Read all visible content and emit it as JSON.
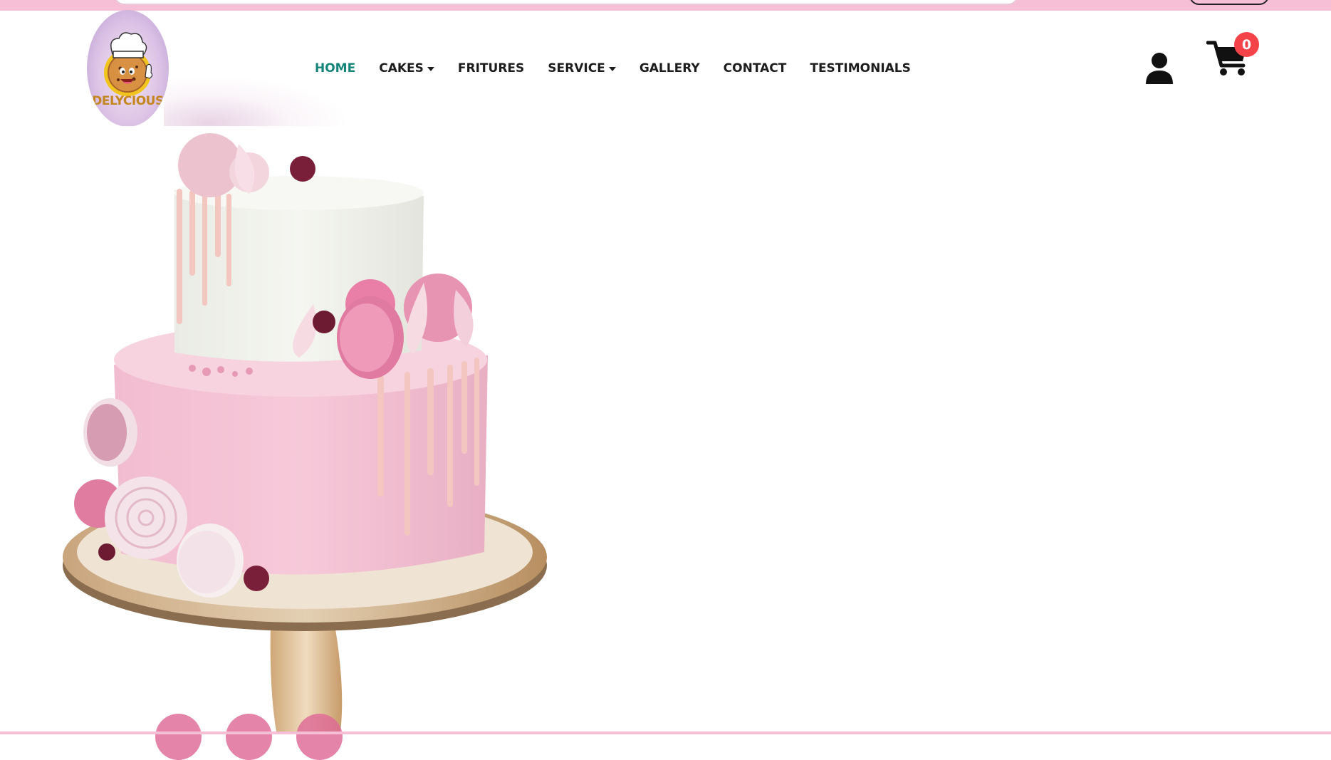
{
  "brand": {
    "logo_text": "DELYCIOUS"
  },
  "nav": {
    "items": [
      {
        "label": "HOME",
        "active": true,
        "dropdown": false
      },
      {
        "label": "CAKES",
        "active": false,
        "dropdown": true
      },
      {
        "label": "FRITURES",
        "active": false,
        "dropdown": false
      },
      {
        "label": "SERVICE",
        "active": false,
        "dropdown": true
      },
      {
        "label": "GALLERY",
        "active": false,
        "dropdown": false
      },
      {
        "label": "CONTACT",
        "active": false,
        "dropdown": false
      },
      {
        "label": "TESTIMONIALS",
        "active": false,
        "dropdown": false
      }
    ]
  },
  "header_actions": {
    "user_icon": "user-icon",
    "cart_icon": "cart-icon",
    "cart_count": "0"
  },
  "hero": {
    "image": "two-tier pink cake with macarons and meringues on wooden stand",
    "slider_dots": 3
  },
  "colors": {
    "topbar": "#f7bfd6",
    "nav_active": "#16857a",
    "nav_text": "#1d1d1d",
    "badge": "#f5434a",
    "dot": "#de6996"
  }
}
